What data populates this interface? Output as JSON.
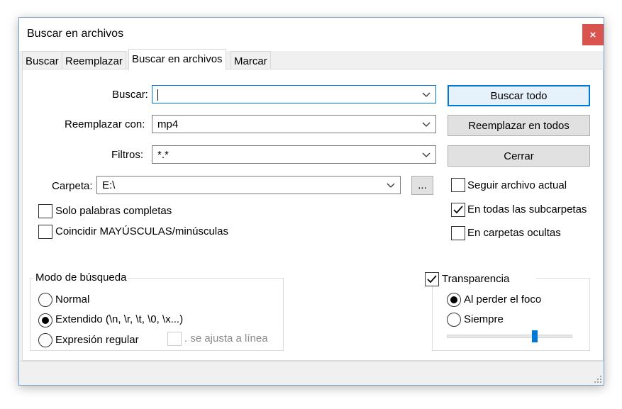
{
  "window": {
    "title": "Buscar en archivos",
    "close_glyph": "×"
  },
  "tabs": [
    {
      "label": "Buscar"
    },
    {
      "label": "Reemplazar"
    },
    {
      "label": "Buscar en archivos",
      "active": true
    },
    {
      "label": "Marcar"
    }
  ],
  "fields": {
    "buscar": {
      "label": "Buscar:",
      "value": ""
    },
    "reemplazar": {
      "label": "Reemplazar con:",
      "value": "mp4"
    },
    "filtros": {
      "label": "Filtros:",
      "value": "*.*"
    },
    "carpeta": {
      "label": "Carpeta:",
      "value": "E:\\",
      "browse_label": "..."
    }
  },
  "buttons": {
    "buscar_todo": "Buscar todo",
    "reemplazar_todos": "Reemplazar en todos",
    "cerrar": "Cerrar"
  },
  "options_left": [
    {
      "label": "Solo palabras completas",
      "checked": false
    },
    {
      "label": "Coincidir MAYÚSCULAS/minúsculas",
      "checked": false
    }
  ],
  "options_right": [
    {
      "label": "Seguir archivo actual",
      "checked": false
    },
    {
      "label": "En todas las subcarpetas",
      "checked": true
    },
    {
      "label": "En carpetas ocultas",
      "checked": false
    }
  ],
  "search_mode": {
    "title": "Modo de búsqueda",
    "options": [
      {
        "label": "Normal",
        "selected": false
      },
      {
        "label": "Extendido (\\n, \\r, \\t, \\0, \\x...)",
        "selected": true
      },
      {
        "label": "Expresión regular",
        "selected": false
      }
    ],
    "dotall_label": ". se ajusta a línea",
    "dotall_checked": false,
    "dotall_enabled": false
  },
  "transparency": {
    "label": "Transparencia",
    "checked": true,
    "options": [
      {
        "label": "Al perder el foco",
        "selected": true
      },
      {
        "label": "Siempre",
        "selected": false
      }
    ],
    "slider_fraction": 0.7
  },
  "colors": {
    "accent": "#0078d7",
    "close": "#d9534f"
  }
}
